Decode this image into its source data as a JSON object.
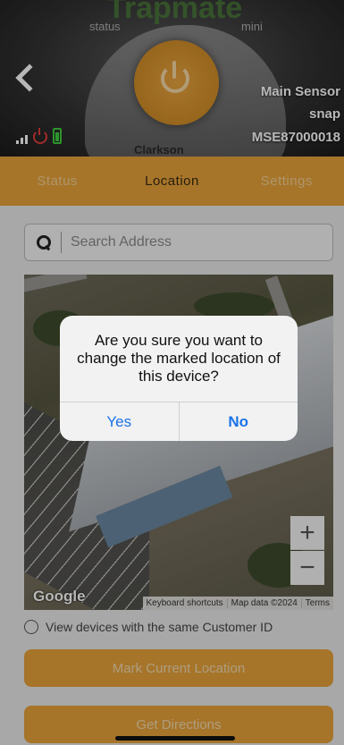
{
  "header": {
    "brand_top": "Trapmate",
    "brand_left": "status",
    "brand_right": "mini",
    "brand_bottom": "Clarkson",
    "device_name": "Main Sensor",
    "device_type": "snap",
    "device_id": "MSE87000018",
    "back_icon": "chevron-left-icon",
    "colors": {
      "power_accent": "#e6a23b",
      "status_red": "#e23b3b",
      "battery_green": "#3ecf3e"
    }
  },
  "tabs": [
    {
      "label": "Status",
      "active": false
    },
    {
      "label": "Location",
      "active": true
    },
    {
      "label": "Settings",
      "active": false
    }
  ],
  "search": {
    "placeholder": "Search Address",
    "value": "",
    "icon": "search-icon"
  },
  "map": {
    "provider": "Google",
    "attribution": [
      "Keyboard shortcuts",
      "Map data ©2024",
      "Terms"
    ],
    "zoom_in": "+",
    "zoom_out": "−"
  },
  "options": {
    "same_customer_label": "View devices with the same Customer ID",
    "checked": false
  },
  "buttons": {
    "mark_location": "Mark Current Location",
    "get_directions": "Get Directions"
  },
  "dialog": {
    "message": "Are you sure you want to change the marked location of this device?",
    "yes": "Yes",
    "no": "No"
  },
  "theme": {
    "accent": "#e6a23b",
    "link": "#1a73e8"
  }
}
